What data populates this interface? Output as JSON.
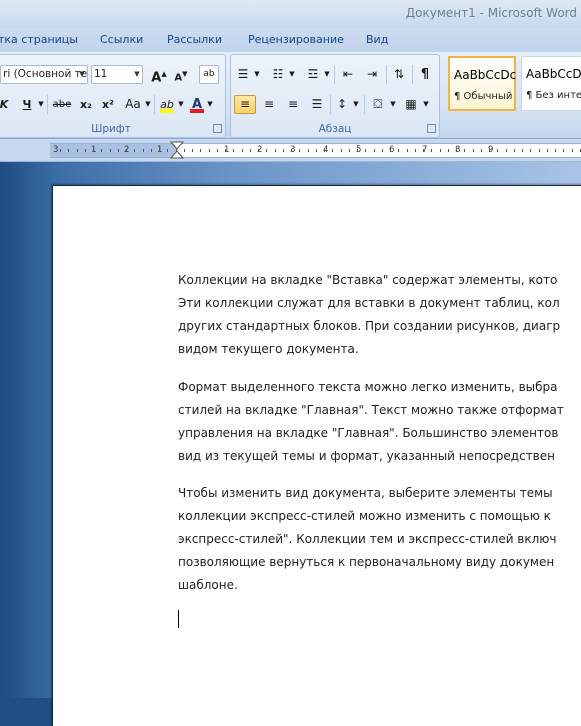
{
  "window": {
    "title": "Документ1 - Microsoft Word"
  },
  "tabs": [
    "тка страницы",
    "Ссылки",
    "Рассылки",
    "Рецензирование",
    "Вид"
  ],
  "font_group": {
    "font_name": "ri (Основной те",
    "font_size": "11",
    "grow_label": "A",
    "shrink_label": "A",
    "clear_label": "ab",
    "italic": "K",
    "underline": "Ч",
    "strike": "abe",
    "subscript": "x₂",
    "superscript": "x²",
    "case": "Aa",
    "highlight": "ab",
    "color": "A",
    "label": "Шрифт"
  },
  "paragraph_group": {
    "label": "Абзац",
    "pilcrow": "¶"
  },
  "styles": [
    {
      "sample": "AaBbCcDc",
      "name": "¶ Обычный"
    },
    {
      "sample": "AaBbCcDc",
      "name": "¶ Без инте..."
    }
  ],
  "ruler": {
    "numbers": [
      "3",
      "1",
      "2",
      "1",
      "1",
      "2",
      "3",
      "4",
      "5",
      "6",
      "7",
      "8",
      "9"
    ]
  },
  "document": {
    "paragraphs": [
      [
        "Коллекции на вкладке \"Вставка\" содержат элементы, кото",
        "Эти коллекции служат для вставки в документ таблиц, кол",
        "других стандартных блоков. При создании рисунков, диагр",
        "видом текущего документа."
      ],
      [
        "Формат выделенного текста можно легко изменить, выбра",
        "стилей на вкладке \"Главная\". Текст можно также отформат",
        "управления на вкладке \"Главная\". Большинство элементов",
        "вид из текущей темы и формат, указанный непосредствен"
      ],
      [
        "Чтобы изменить вид документа, выберите элементы темы",
        "коллекции экспресс-стилей можно изменить с помощью к",
        "экспресс-стилей\". Коллекции тем и экспресс-стилей включ",
        "позволяющие вернуться к первоначальному виду докумен",
        "шаблоне."
      ]
    ]
  },
  "colors": {
    "highlight": "#ffff00",
    "font_color": "#e02020",
    "accent": "#15428b"
  }
}
